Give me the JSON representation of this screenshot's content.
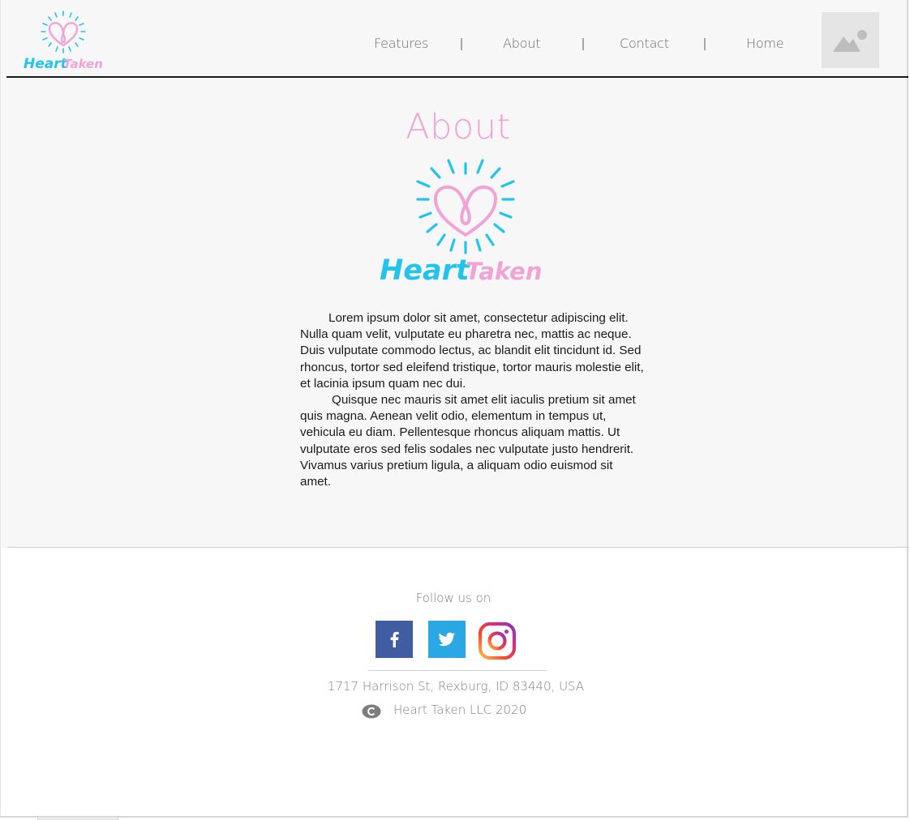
{
  "brand": {
    "name_part1": "Heart",
    "name_part2": "Taken"
  },
  "nav": {
    "items": [
      {
        "label": "Features"
      },
      {
        "label": "About"
      },
      {
        "label": "Contact"
      },
      {
        "label": "Home"
      }
    ]
  },
  "header": {
    "image_icon": "image-placeholder-icon"
  },
  "about": {
    "title": "About",
    "paragraphs": [
      "Lorem ipsum dolor sit amet, consectetur adipiscing elit. Nulla quam velit, vulputate eu pharetra nec, mattis ac neque. Duis vulputate commodo lectus, ac blandit elit tincidunt id. Sed rhoncus, tortor sed eleifend tristique, tortor mauris molestie elit, et lacinia ipsum quam nec dui.",
      "Quisque nec mauris sit amet elit iaculis pretium sit amet quis magna. Aenean velit odio, elementum in tempus ut, vehicula eu diam. Pellentesque rhoncus aliquam mattis. Ut vulputate eros sed felis sodales nec vulputate justo hendrerit. Vivamus varius pretium ligula, a aliquam odio euismod sit amet."
    ]
  },
  "footer": {
    "follow_label": "Follow us on",
    "social": [
      {
        "name": "facebook",
        "icon": "facebook-icon"
      },
      {
        "name": "twitter",
        "icon": "twitter-icon"
      },
      {
        "name": "instagram",
        "icon": "instagram-icon"
      }
    ],
    "address": "1717 Harrison St, Rexburg, ID 83440, USA",
    "copyright": "Heart Taken LLC 2020"
  },
  "colors": {
    "pink": "#f2a3d6",
    "cyan": "#22c4ef",
    "facebook": "#3f5da0",
    "twitter": "#2aa8e3"
  }
}
